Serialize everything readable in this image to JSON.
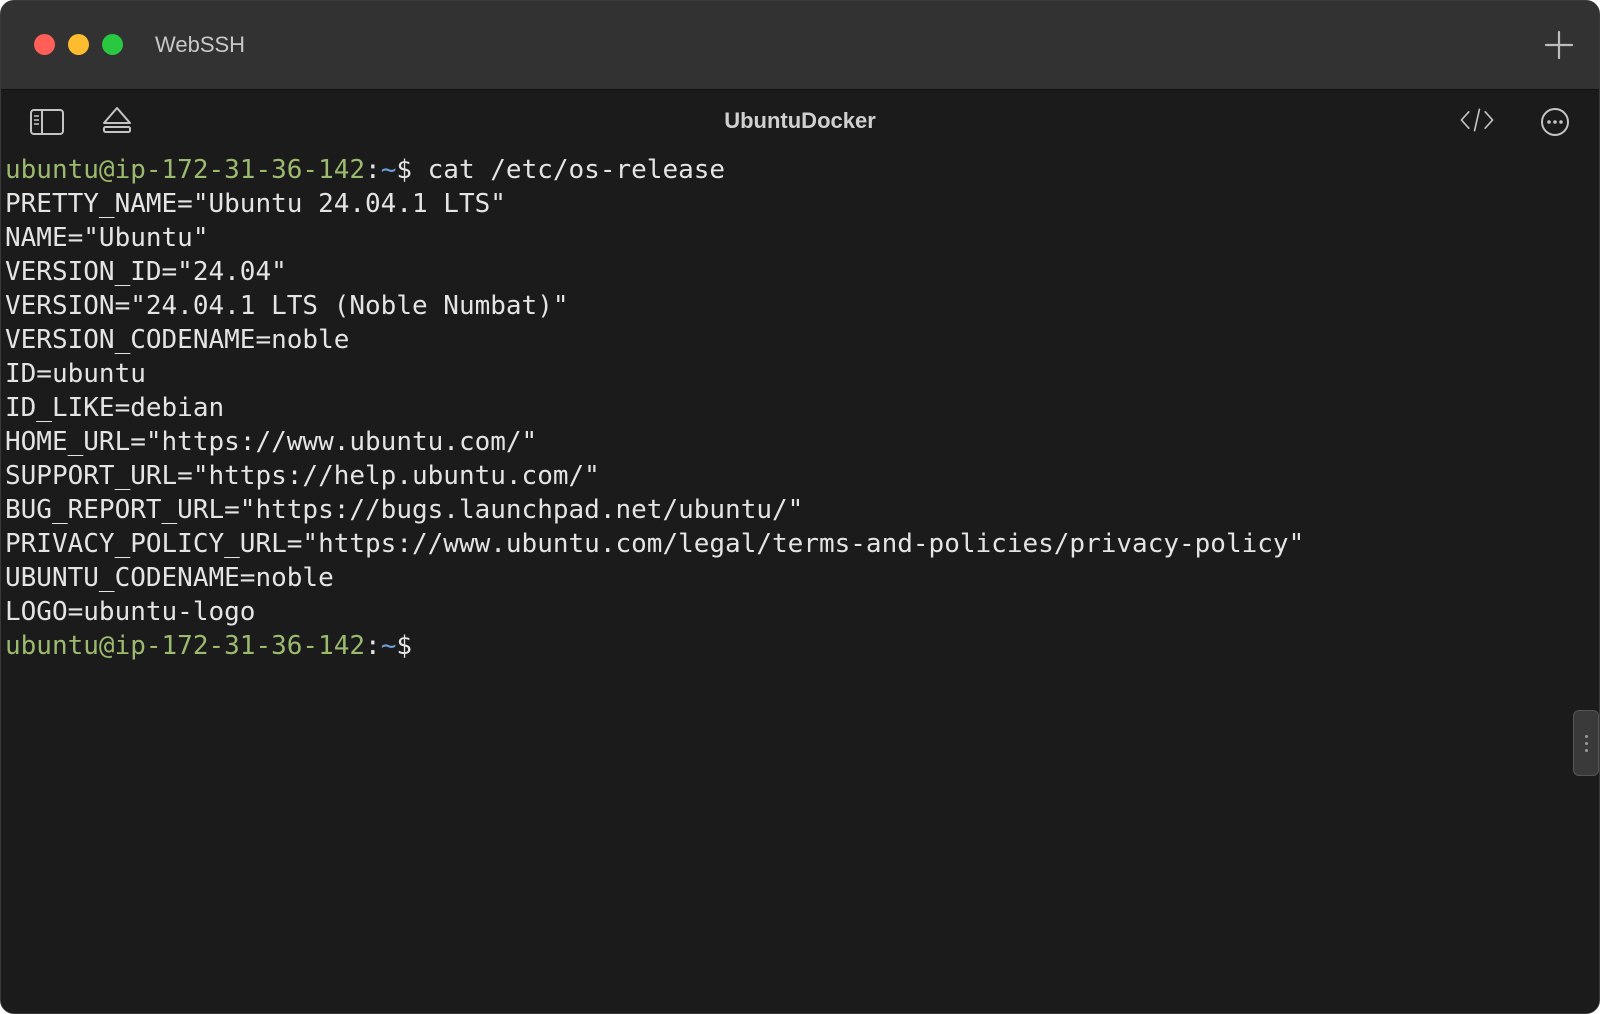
{
  "window": {
    "title": "WebSSH"
  },
  "toolbar": {
    "host_title": "UbuntuDocker"
  },
  "colors": {
    "prompt_user": "#9cba6e",
    "prompt_path": "#6f9fd8",
    "text": "#e4e4e4",
    "background": "#1b1b1b"
  },
  "terminal": {
    "prompt_user_host": "ubuntu@ip-172-31-36-142",
    "prompt_colon": ":",
    "prompt_path": "~",
    "prompt_symbol": "$",
    "command": " cat /etc/os-release",
    "output": [
      "PRETTY_NAME=\"Ubuntu 24.04.1 LTS\"",
      "NAME=\"Ubuntu\"",
      "VERSION_ID=\"24.04\"",
      "VERSION=\"24.04.1 LTS (Noble Numbat)\"",
      "VERSION_CODENAME=noble",
      "ID=ubuntu",
      "ID_LIKE=debian",
      "HOME_URL=\"https://www.ubuntu.com/\"",
      "SUPPORT_URL=\"https://help.ubuntu.com/\"",
      "BUG_REPORT_URL=\"https://bugs.launchpad.net/ubuntu/\"",
      "PRIVACY_POLICY_URL=\"https://www.ubuntu.com/legal/terms-and-policies/privacy-policy\"",
      "UBUNTU_CODENAME=noble",
      "LOGO=ubuntu-logo"
    ]
  },
  "icons": {
    "sidebar": "sidebar-icon",
    "eject": "eject-icon",
    "code": "code-icon",
    "more": "more-icon",
    "new_tab": "plus-icon"
  }
}
